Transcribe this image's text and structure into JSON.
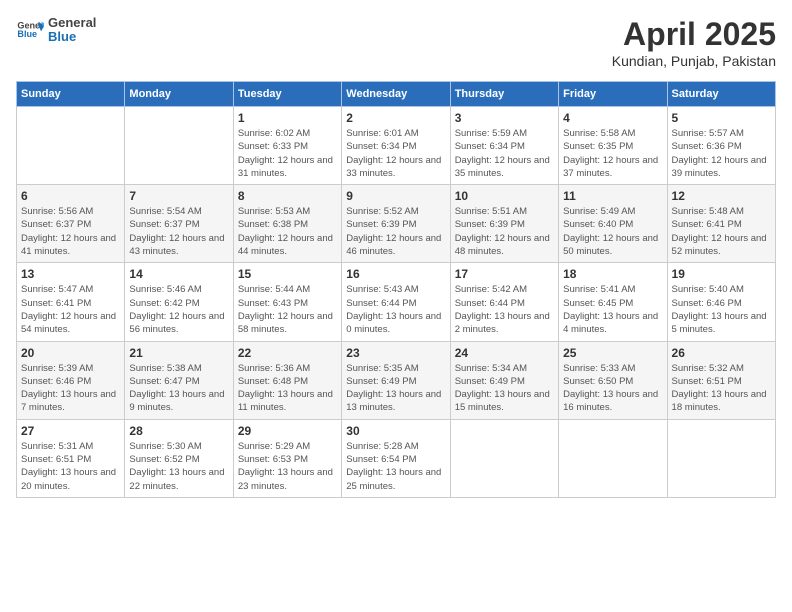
{
  "header": {
    "logo_general": "General",
    "logo_blue": "Blue",
    "title": "April 2025",
    "subtitle": "Kundian, Punjab, Pakistan"
  },
  "weekdays": [
    "Sunday",
    "Monday",
    "Tuesday",
    "Wednesday",
    "Thursday",
    "Friday",
    "Saturday"
  ],
  "weeks": [
    [
      {
        "day": "",
        "detail": ""
      },
      {
        "day": "",
        "detail": ""
      },
      {
        "day": "1",
        "detail": "Sunrise: 6:02 AM\nSunset: 6:33 PM\nDaylight: 12 hours and 31 minutes."
      },
      {
        "day": "2",
        "detail": "Sunrise: 6:01 AM\nSunset: 6:34 PM\nDaylight: 12 hours and 33 minutes."
      },
      {
        "day": "3",
        "detail": "Sunrise: 5:59 AM\nSunset: 6:34 PM\nDaylight: 12 hours and 35 minutes."
      },
      {
        "day": "4",
        "detail": "Sunrise: 5:58 AM\nSunset: 6:35 PM\nDaylight: 12 hours and 37 minutes."
      },
      {
        "day": "5",
        "detail": "Sunrise: 5:57 AM\nSunset: 6:36 PM\nDaylight: 12 hours and 39 minutes."
      }
    ],
    [
      {
        "day": "6",
        "detail": "Sunrise: 5:56 AM\nSunset: 6:37 PM\nDaylight: 12 hours and 41 minutes."
      },
      {
        "day": "7",
        "detail": "Sunrise: 5:54 AM\nSunset: 6:37 PM\nDaylight: 12 hours and 43 minutes."
      },
      {
        "day": "8",
        "detail": "Sunrise: 5:53 AM\nSunset: 6:38 PM\nDaylight: 12 hours and 44 minutes."
      },
      {
        "day": "9",
        "detail": "Sunrise: 5:52 AM\nSunset: 6:39 PM\nDaylight: 12 hours and 46 minutes."
      },
      {
        "day": "10",
        "detail": "Sunrise: 5:51 AM\nSunset: 6:39 PM\nDaylight: 12 hours and 48 minutes."
      },
      {
        "day": "11",
        "detail": "Sunrise: 5:49 AM\nSunset: 6:40 PM\nDaylight: 12 hours and 50 minutes."
      },
      {
        "day": "12",
        "detail": "Sunrise: 5:48 AM\nSunset: 6:41 PM\nDaylight: 12 hours and 52 minutes."
      }
    ],
    [
      {
        "day": "13",
        "detail": "Sunrise: 5:47 AM\nSunset: 6:41 PM\nDaylight: 12 hours and 54 minutes."
      },
      {
        "day": "14",
        "detail": "Sunrise: 5:46 AM\nSunset: 6:42 PM\nDaylight: 12 hours and 56 minutes."
      },
      {
        "day": "15",
        "detail": "Sunrise: 5:44 AM\nSunset: 6:43 PM\nDaylight: 12 hours and 58 minutes."
      },
      {
        "day": "16",
        "detail": "Sunrise: 5:43 AM\nSunset: 6:44 PM\nDaylight: 13 hours and 0 minutes."
      },
      {
        "day": "17",
        "detail": "Sunrise: 5:42 AM\nSunset: 6:44 PM\nDaylight: 13 hours and 2 minutes."
      },
      {
        "day": "18",
        "detail": "Sunrise: 5:41 AM\nSunset: 6:45 PM\nDaylight: 13 hours and 4 minutes."
      },
      {
        "day": "19",
        "detail": "Sunrise: 5:40 AM\nSunset: 6:46 PM\nDaylight: 13 hours and 5 minutes."
      }
    ],
    [
      {
        "day": "20",
        "detail": "Sunrise: 5:39 AM\nSunset: 6:46 PM\nDaylight: 13 hours and 7 minutes."
      },
      {
        "day": "21",
        "detail": "Sunrise: 5:38 AM\nSunset: 6:47 PM\nDaylight: 13 hours and 9 minutes."
      },
      {
        "day": "22",
        "detail": "Sunrise: 5:36 AM\nSunset: 6:48 PM\nDaylight: 13 hours and 11 minutes."
      },
      {
        "day": "23",
        "detail": "Sunrise: 5:35 AM\nSunset: 6:49 PM\nDaylight: 13 hours and 13 minutes."
      },
      {
        "day": "24",
        "detail": "Sunrise: 5:34 AM\nSunset: 6:49 PM\nDaylight: 13 hours and 15 minutes."
      },
      {
        "day": "25",
        "detail": "Sunrise: 5:33 AM\nSunset: 6:50 PM\nDaylight: 13 hours and 16 minutes."
      },
      {
        "day": "26",
        "detail": "Sunrise: 5:32 AM\nSunset: 6:51 PM\nDaylight: 13 hours and 18 minutes."
      }
    ],
    [
      {
        "day": "27",
        "detail": "Sunrise: 5:31 AM\nSunset: 6:51 PM\nDaylight: 13 hours and 20 minutes."
      },
      {
        "day": "28",
        "detail": "Sunrise: 5:30 AM\nSunset: 6:52 PM\nDaylight: 13 hours and 22 minutes."
      },
      {
        "day": "29",
        "detail": "Sunrise: 5:29 AM\nSunset: 6:53 PM\nDaylight: 13 hours and 23 minutes."
      },
      {
        "day": "30",
        "detail": "Sunrise: 5:28 AM\nSunset: 6:54 PM\nDaylight: 13 hours and 25 minutes."
      },
      {
        "day": "",
        "detail": ""
      },
      {
        "day": "",
        "detail": ""
      },
      {
        "day": "",
        "detail": ""
      }
    ]
  ]
}
